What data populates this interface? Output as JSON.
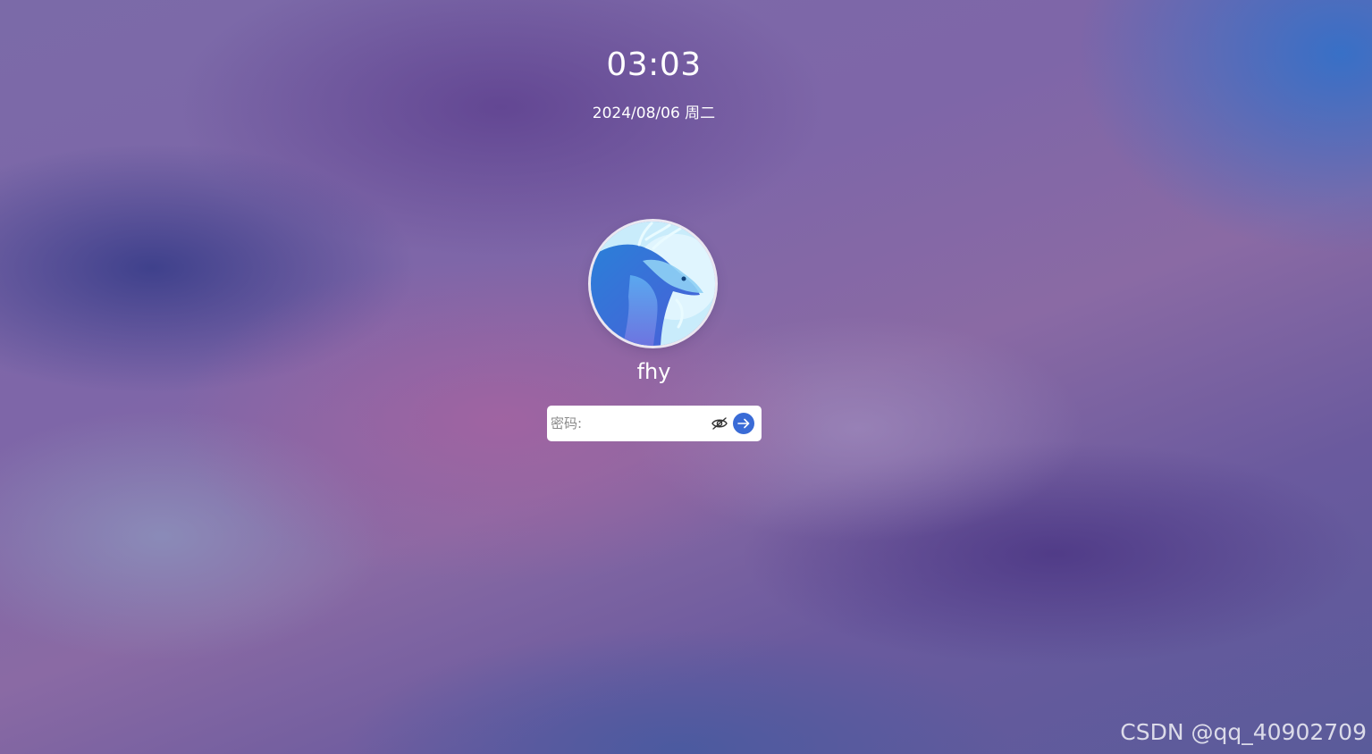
{
  "lock_screen": {
    "time": "03:03",
    "date": "2024/08/06 周二",
    "user": {
      "name": "fhy",
      "avatar_icon": "dragon-avatar-icon"
    },
    "password": {
      "placeholder": "密码:",
      "value": "",
      "toggle_icon": "eye-slash-icon",
      "submit_icon": "arrow-right-icon"
    },
    "colors": {
      "submit_button": "#3a6bd6",
      "field_background": "#ffffff"
    }
  },
  "watermark": {
    "text": "CSDN @qq_40902709"
  }
}
